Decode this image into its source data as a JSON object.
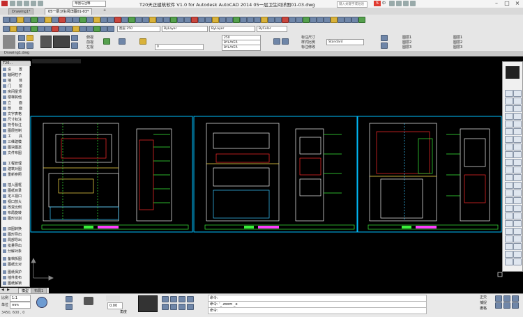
{
  "title_bar": {
    "title": "T20天正建筑软件 V1.0 for Autodesk AutoCAD 2014   05一层卫生间详图01-03.dwg",
    "quick_access": "草图与注释",
    "search_placeholder": "键入关键字或短语",
    "ime_badge": "S",
    "ime_label": "中"
  },
  "doc_tabs": [
    {
      "label": "Drawing1*"
    },
    {
      "label": "05一层卫生间详图01-03*"
    }
  ],
  "toolbar": {
    "layer_current": "图层 250",
    "layer_dropdown": "图层 250",
    "color": "ByLayer",
    "linetype": "ByLayer",
    "lineweight": "ByColor",
    "layer_name": "250",
    "bylayer_a": "BYLAYER",
    "bylayer_b": "BYLAYER",
    "layer_state": "0",
    "style_standard": "Standard",
    "view_buttons": [
      "俯视",
      "前视",
      "左视"
    ],
    "right_labels": [
      "标注尺寸",
      "样式比例",
      "标注修改"
    ],
    "layer_items": [
      "图层1",
      "图层2",
      "图层3"
    ],
    "doc_label": "Drawing1.dwg"
  },
  "palette": {
    "header": "T20...",
    "items": [
      {
        "label": "设　置"
      },
      {
        "label": "轴网柱子"
      },
      {
        "label": "墙　体"
      },
      {
        "label": "门　窗"
      },
      {
        "label": "房间屋顶"
      },
      {
        "label": "楼梯其他"
      },
      {
        "label": "立　面"
      },
      {
        "label": "剖　面"
      },
      {
        "label": "文字表格"
      },
      {
        "label": "尺寸标注"
      },
      {
        "label": "符号标注"
      },
      {
        "label": "图层控制"
      },
      {
        "label": "工　具"
      },
      {
        "label": "三维建模"
      },
      {
        "label": "图块图案"
      },
      {
        "label": "文件布图"
      },
      {
        "label": "工程管理"
      },
      {
        "label": "建筑对图"
      },
      {
        "label": "重新参照"
      },
      {
        "label": "插入图框"
      },
      {
        "label": "图纸目录"
      },
      {
        "label": "定义视口"
      },
      {
        "label": "视口放大"
      },
      {
        "label": "改变比例"
      },
      {
        "label": "布局旋转"
      },
      {
        "label": "图形切割"
      },
      {
        "label": "旧图转换"
      },
      {
        "label": "图形导出"
      },
      {
        "label": "局部导出"
      },
      {
        "label": "批量导出"
      },
      {
        "label": "分解对象"
      },
      {
        "label": "备档拆图"
      },
      {
        "label": "图纸比对"
      },
      {
        "label": "图纸保护"
      },
      {
        "label": "插件发布"
      },
      {
        "label": "图纸解锁"
      }
    ]
  },
  "layout_tabs": [
    "模型",
    "布局1"
  ],
  "status": {
    "scale_label": "比例",
    "scale_value": "1:1",
    "unit_label": "单位",
    "unit_value": "mm",
    "coords": "3450, 600 , 0",
    "number_value": "0.00",
    "angle_label": "角度",
    "cmd_lines": [
      "命令:",
      "命令: '_.zoom _e",
      "命令:"
    ],
    "right_labels": [
      "正交",
      "捕捉",
      "栅格"
    ]
  }
}
